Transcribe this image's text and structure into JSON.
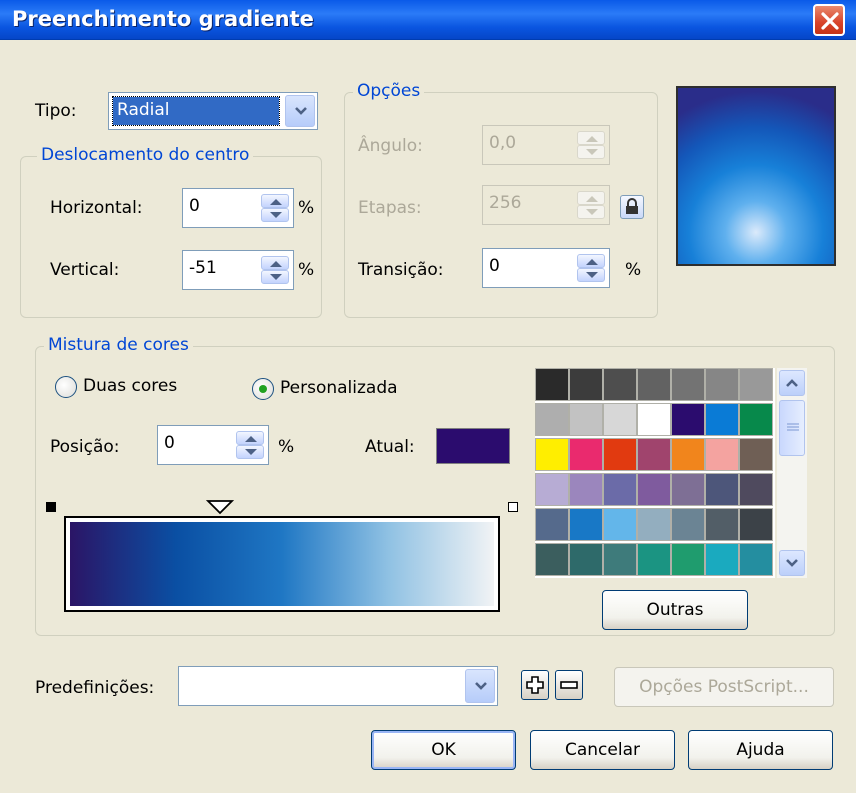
{
  "window": {
    "title": "Preenchimento gradiente"
  },
  "tipo": {
    "label": "Tipo:",
    "value": "Radial"
  },
  "offset": {
    "legend": "Deslocamento do centro",
    "horizontal": {
      "label": "Horizontal:",
      "value": "0",
      "unit": "%"
    },
    "vertical": {
      "label": "Vertical:",
      "value": "-51",
      "unit": "%"
    }
  },
  "options": {
    "legend": "Opções",
    "angle": {
      "label": "Ângulo:",
      "value": "0,0"
    },
    "steps": {
      "label": "Etapas:",
      "value": "256"
    },
    "transition": {
      "label": "Transição:",
      "value": "0",
      "unit": "%"
    }
  },
  "color_blend": {
    "legend": "Mistura de cores",
    "two_colors": "Duas cores",
    "custom": "Personalizada",
    "position": {
      "label": "Posição:",
      "value": "0",
      "unit": "%"
    },
    "current": {
      "label": "Atual:",
      "color": "#2b0c6e"
    },
    "gradient_stops": [
      "#2b1566",
      "#0a4fa3",
      "#1f77c4",
      "#8fc1e3",
      "#f1f3f5"
    ],
    "others_button": "Outras"
  },
  "palette": [
    [
      "#2a2a2a",
      "#3c3c3c",
      "#4e4e4e",
      "#626262",
      "#737373",
      "#868686",
      "#999999"
    ],
    [
      "#aeaeae",
      "#c2c2c2",
      "#d7d7d7",
      "#ffffff",
      "#2b0c6e",
      "#0a7bd6",
      "#07894b"
    ],
    [
      "#ffee00",
      "#ea2a6e",
      "#e13a10",
      "#a0446d",
      "#f1851c",
      "#f4a3a0",
      "#6f5f55"
    ],
    [
      "#b7acd4",
      "#9b86bd",
      "#6b6ba8",
      "#7f5b9e",
      "#7e6f95",
      "#4d567a",
      "#4f4a5e"
    ],
    [
      "#556a8c",
      "#1878c6",
      "#63b6ea",
      "#93aebf",
      "#6b8494",
      "#525e67",
      "#3c4248"
    ],
    [
      "#3b5e5e",
      "#2e6a6a",
      "#3e7b7b",
      "#1b9482",
      "#1f9c6e",
      "#1aaabf",
      "#248ea0"
    ]
  ],
  "presets": {
    "label": "Predefinições:",
    "value": "",
    "postscript_button": "Opções PostScript..."
  },
  "buttons": {
    "ok": "OK",
    "cancel": "Cancelar",
    "help": "Ajuda"
  },
  "preview": {
    "outer": "#1c3fa8",
    "inner": "#dbeafb"
  }
}
